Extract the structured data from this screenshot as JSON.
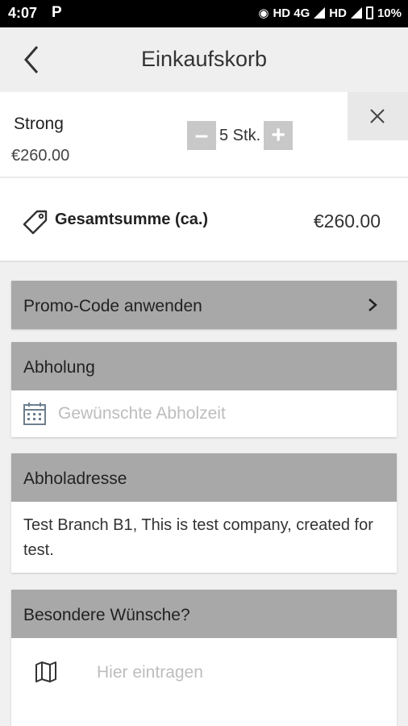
{
  "status_bar": {
    "time": "4:07",
    "app_icon": "P",
    "network": "HD 4G",
    "network2": "HD",
    "battery": "10%"
  },
  "header": {
    "title": "Einkaufskorb"
  },
  "cart_item": {
    "name": "Strong",
    "price": "€260.00",
    "quantity": "5 Stk.",
    "minus": "–",
    "plus": "+"
  },
  "total": {
    "label": "Gesamtsumme (ca.)",
    "value": "€260.00"
  },
  "promo": {
    "label": "Promo-Code anwenden"
  },
  "pickup": {
    "header": "Abholung",
    "placeholder": "Gewünschte Abholzeit"
  },
  "address": {
    "header": "Abholadresse",
    "text": "Test Branch B1, This is test company, created for test."
  },
  "wishes": {
    "header": "Besondere Wünsche?",
    "placeholder": "Hier eintragen"
  },
  "colors": {
    "section_header": "#a8a8a8",
    "stepper": "#c8c8c8",
    "background": "#f0f0f0"
  }
}
